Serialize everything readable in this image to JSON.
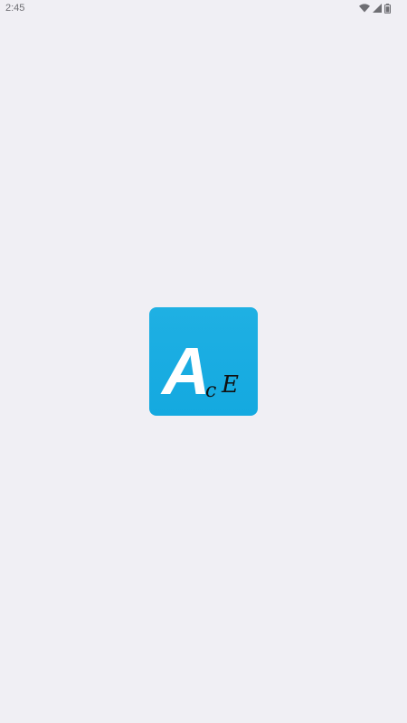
{
  "status_bar": {
    "time": "2:45",
    "icons": [
      "wifi-icon",
      "signal-icon",
      "battery-icon"
    ]
  },
  "splash": {
    "logo_text": "AcE",
    "logo_bg_color": "#18ade2",
    "logo_main_letter_color": "#ffffff",
    "logo_small_letters_color": "#111111"
  }
}
